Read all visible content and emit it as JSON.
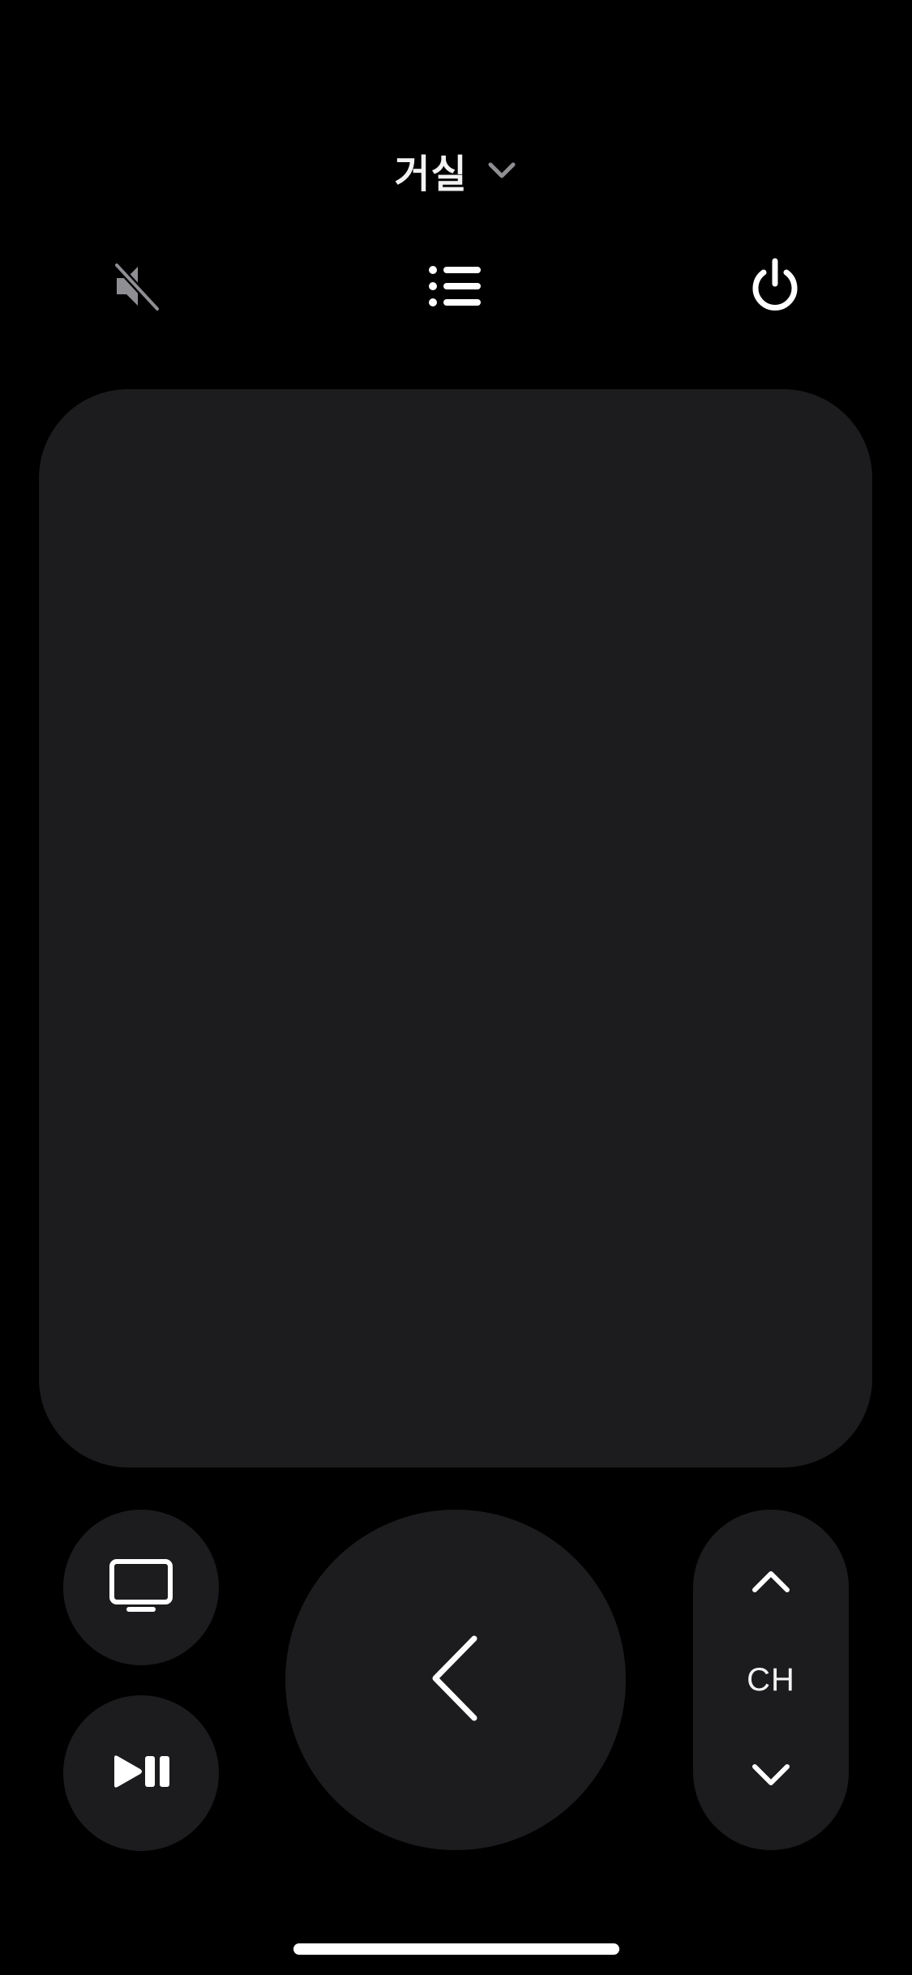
{
  "header": {
    "device_name": "거실",
    "device_dropdown_icon": "chevron-down-icon"
  },
  "top_controls": {
    "mute_icon": "speaker-muted-icon",
    "guide_icon": "list-icon",
    "power_icon": "power-icon"
  },
  "bottom_controls": {
    "tv_icon": "tv-icon",
    "play_pause_icon": "play-pause-icon",
    "back_icon": "chevron-left-icon",
    "channel": {
      "label": "CH",
      "up_icon": "chevron-up-icon",
      "down_icon": "chevron-down-icon"
    }
  },
  "colors": {
    "background": "#000000",
    "surface": "#1c1c1e",
    "foreground": "#ffffff",
    "muted": "#8e8e93"
  }
}
